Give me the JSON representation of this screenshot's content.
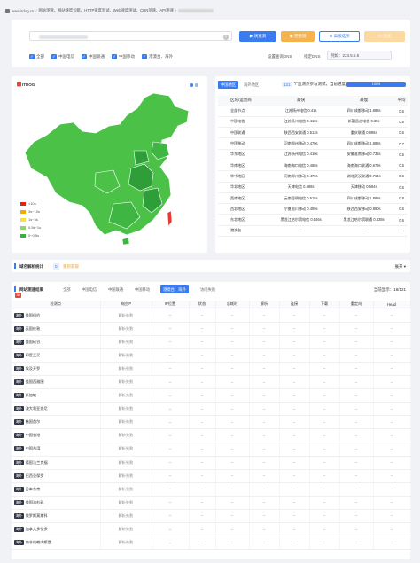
{
  "breadcrumb": {
    "items": [
      "www.itdog.cn",
      "网站测速、网站速度诊断、HTTP速度测试、Web速度测试、CDN测速、API测速"
    ]
  },
  "search": {
    "buttons": {
      "quick": "快速测",
      "complete": "完整测",
      "advanced": "高级选项",
      "ai": "AI 优化"
    },
    "clear_glyph": "×",
    "filters": [
      "全部",
      "中国电信",
      "中国联通",
      "中国移动",
      "港澳台、海外"
    ],
    "check_glyph": "✓",
    "dns_label": "设置查询DNS",
    "dns_label2": "指定DNS",
    "dns_value": "例如：223.5.5.5"
  },
  "map": {
    "logo": "ITDOG",
    "legend": [
      {
        "label": ">10s",
        "color": "#d9261c"
      },
      {
        "label": "3s~10s",
        "color": "#f2a900"
      },
      {
        "label": "1s~3s",
        "color": "#f5e04a"
      },
      {
        "label": "0.5s~1s",
        "color": "#8fd36b"
      },
      {
        "label": "0~0.5s",
        "color": "#36b33c"
      }
    ],
    "regions_fill": {
      "base": "#4bc247",
      "dark": "#2d9e38",
      "mid": "#3fb543",
      "red": "#e23b30"
    }
  },
  "stats": {
    "tabs": [
      "中国地区",
      "海外地区"
    ],
    "progress_count": "121",
    "progress_text": "个监测点参与测试，当前进度：",
    "progress_value": "100%",
    "columns": [
      "区域/运营商",
      "最快",
      "最慢",
      "平均"
    ],
    "rows": [
      [
        "全部节点",
        "江苏扬州电信 0.41s",
        "四川成都移动 1.888s",
        "0.6"
      ],
      [
        "中国电信",
        "江苏扬州电信 0.410s",
        "新疆昌吉电信 0.85s",
        "0.6"
      ],
      [
        "中国联通",
        "陕西西安联通 0.513s",
        "重庆联通 0.896s",
        "0.6"
      ],
      [
        "中国移动",
        "河南郑州移动 0.470s",
        "四川成都移动 1.888s",
        "0.7"
      ],
      [
        "华东地区",
        "江苏扬州电信 0.410s",
        "安徽淮南移动 0.735s",
        "0.5"
      ],
      [
        "华南地区",
        "海南海口电信 0.488s",
        "海南海口联通 0.679s",
        "0.5"
      ],
      [
        "华中地区",
        "河南郑州移动 0.470s",
        "湖北武汉联通 0.764s",
        "0.6"
      ],
      [
        "华北地区",
        "天津电信 0.498s",
        "天津移动 0.684s",
        "0.6"
      ],
      [
        "西南地区",
        "云南昆明电信 0.615s",
        "四川成都移动 1.888s",
        "0.8"
      ],
      [
        "西北地区",
        "宁夏银川移动 0.499s",
        "陕西西安移动 0.890s",
        "0.6"
      ],
      [
        "东北地区",
        "黑龙江哈尔滨电信 0.546s",
        "黑龙江哈尔滨联通 0.838s",
        "0.6"
      ],
      [
        "港澳台",
        "--",
        "--",
        "--"
      ]
    ]
  },
  "dns_bar": {
    "title": "域名解析统计",
    "badge": "0",
    "tip": "重新获取",
    "expand": "展开 ▾"
  },
  "results": {
    "title": "网站测速结果",
    "count_badge": "30",
    "tabs": [
      "全部",
      "中国电信",
      "中国联通",
      "中国移动",
      "港澳台、海外",
      "访问失败"
    ],
    "active_tab": 4,
    "summary": "当前显示：18/121",
    "columns": [
      "检测点",
      "响应IP",
      "IP位置",
      "状态",
      "总耗时",
      "解析",
      "连接",
      "下载",
      "重定向",
      "Head"
    ],
    "fail_text": "解析失败",
    "empty": "--",
    "rows": [
      {
        "region": "海外",
        "node": "美国纽约"
      },
      {
        "region": "海外",
        "node": "英国伦敦"
      },
      {
        "region": "海外",
        "node": "美国硅谷"
      },
      {
        "region": "海外",
        "node": "印度孟买"
      },
      {
        "region": "海外",
        "node": "埃及开罗"
      },
      {
        "region": "海外",
        "node": "美国西雅图"
      },
      {
        "region": "海外",
        "node": "新加坡"
      },
      {
        "region": "海外",
        "node": "澳大利亚悉尼"
      },
      {
        "region": "海外",
        "node": "韩国首尔"
      },
      {
        "region": "海外",
        "node": "中国香港"
      },
      {
        "region": "海外",
        "node": "中国台湾"
      },
      {
        "region": "海外",
        "node": "德国法兰克福"
      },
      {
        "region": "海外",
        "node": "巴西圣保罗"
      },
      {
        "region": "海外",
        "node": "日本东京"
      },
      {
        "region": "海外",
        "node": "美国洛杉矶"
      },
      {
        "region": "海外",
        "node": "俄罗斯莫斯科"
      },
      {
        "region": "海外",
        "node": "加拿大多伦多"
      },
      {
        "region": "海外",
        "node": "南非约翰内斯堡"
      }
    ]
  }
}
